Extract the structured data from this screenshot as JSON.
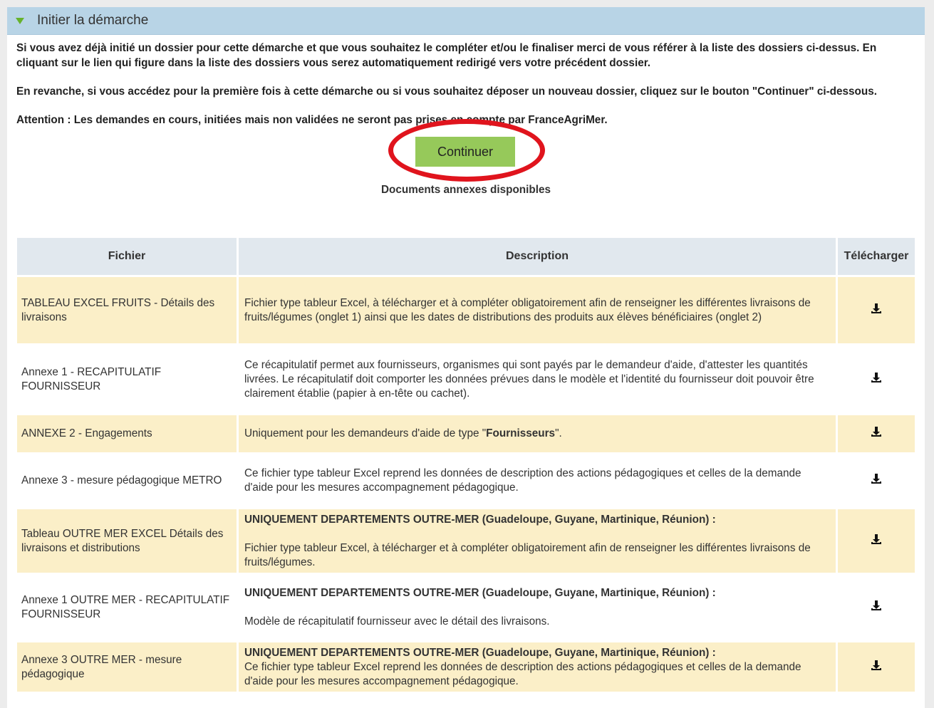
{
  "panel": {
    "title": "Initier la démarche"
  },
  "intro": {
    "p1": "Si vous avez déjà initié un dossier pour cette démarche et que vous souhaitez le compléter et/ou le finaliser merci de vous référer à la liste des dossiers ci-dessus. En cliquant sur le lien qui figure dans la liste des dossiers vous serez automatiquement redirigé vers votre précédent dossier.",
    "p2": "En revanche, si vous accédez pour la première fois à cette démarche ou si vous souhaitez déposer un nouveau dossier, cliquez sur le bouton \"Continuer\" ci-dessous.",
    "p3": "Attention : Les demandes en cours, initiées mais non validées ne seront pas prises en compte par FranceAgriMer."
  },
  "continue_label": "Continuer",
  "docs_title": "Documents annexes disponibles",
  "table": {
    "headers": {
      "file": "Fichier",
      "description": "Description",
      "download": "Télécharger"
    },
    "rows": [
      {
        "file": "TABLEAU EXCEL FRUITS - Détails des livraisons",
        "desc_bold": "",
        "desc": "Fichier type tableur Excel, à télécharger et à compléter obligatoirement afin de renseigner les différentes livraisons de fruits/légumes (onglet 1) ainsi que les dates de distributions des produits aux élèves bénéficiaires (onglet 2)"
      },
      {
        "file": "Annexe 1 - RECAPITULATIF FOURNISSEUR",
        "desc_bold": "",
        "desc": "Ce récapitulatif permet aux fournisseurs, organismes qui sont payés par le demandeur d'aide, d'attester les quantités livrées. Le récapitulatif doit comporter les données prévues dans le modèle et l'identité du fournisseur doit pouvoir être clairement établie (papier à en-tête ou cachet)."
      },
      {
        "file": "ANNEXE 2 - Engagements",
        "desc_pre": "Uniquement pour les demandeurs d'aide de type \"",
        "desc_strong": "Fournisseurs",
        "desc_post": "\"."
      },
      {
        "file": "Annexe 3 - mesure pédagogique METRO",
        "desc_bold": "",
        "desc": "Ce fichier type tableur Excel reprend les données de description des actions pédagogiques et celles de la demande d'aide pour les mesures accompagnement pédagogique."
      },
      {
        "file": "Tableau OUTRE MER EXCEL Détails des livraisons et distributions",
        "desc_bold": "UNIQUEMENT DEPARTEMENTS OUTRE-MER (Guadeloupe, Guyane, Martinique, Réunion) :",
        "desc": "Fichier type tableur Excel, à télécharger et à compléter obligatoirement afin de renseigner les différentes livraisons de fruits/légumes."
      },
      {
        "file": "Annexe 1 OUTRE MER - RECAPITULATIF FOURNISSEUR",
        "desc_bold": "UNIQUEMENT DEPARTEMENTS OUTRE-MER (Guadeloupe, Guyane, Martinique, Réunion) :",
        "desc": " Modèle de récapitulatif fournisseur avec le détail des livraisons."
      },
      {
        "file": "Annexe 3 OUTRE MER - mesure pédagogique",
        "desc_bold": "UNIQUEMENT DEPARTEMENTS OUTRE-MER (Guadeloupe, Guyane, Martinique, Réunion) :",
        "desc": "Ce fichier type tableur Excel reprend les données de description des actions pédagogiques et celles de la demande d'aide pour les mesures accompagnement pédagogique."
      }
    ]
  },
  "icons": {
    "download": "download-icon",
    "expand": "triangle-down-icon"
  },
  "colors": {
    "header_bg": "#b8d4e6",
    "button_green": "#96c95a",
    "row_highlight": "#fbefc8",
    "annotation_red": "#e0141d"
  }
}
